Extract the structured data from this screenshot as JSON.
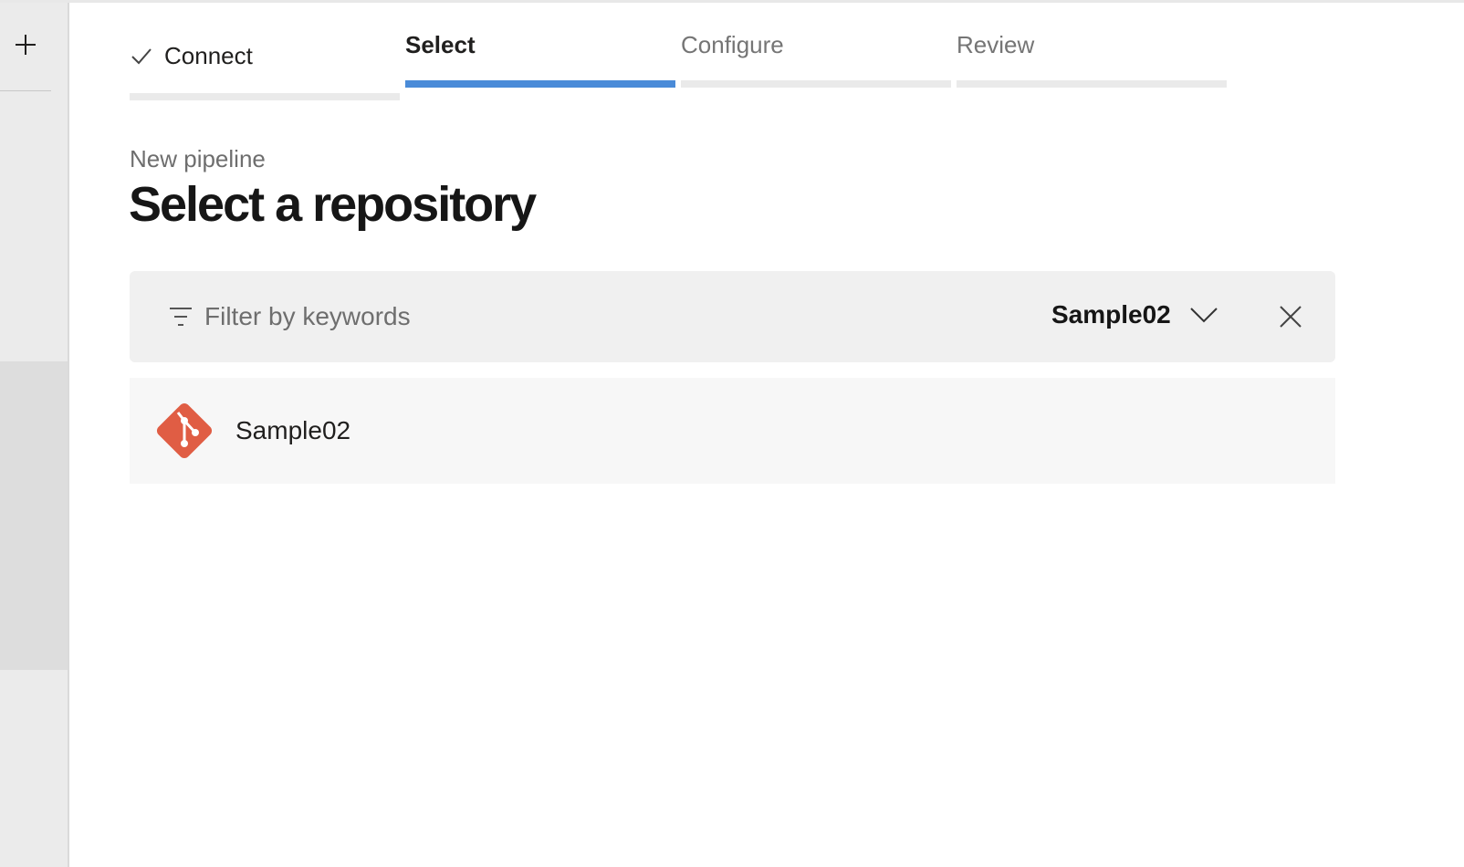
{
  "rail": {
    "add_icon": "plus-icon"
  },
  "stepper": {
    "steps": [
      {
        "label": "Connect",
        "state": "completed",
        "icon": "check-icon"
      },
      {
        "label": "Select",
        "state": "active"
      },
      {
        "label": "Configure",
        "state": "pending"
      },
      {
        "label": "Review",
        "state": "pending"
      }
    ],
    "active_color": "#4a8bd8"
  },
  "header": {
    "subtitle": "New pipeline",
    "title": "Select a repository"
  },
  "filter": {
    "placeholder": "Filter by keywords",
    "value": "",
    "icon": "filter-icon",
    "organization": "Sample02",
    "dropdown_icon": "chevron-down-icon",
    "clear_icon": "close-icon"
  },
  "repositories": [
    {
      "name": "Sample02",
      "icon": "git-icon",
      "icon_color": "#e05d44"
    }
  ]
}
